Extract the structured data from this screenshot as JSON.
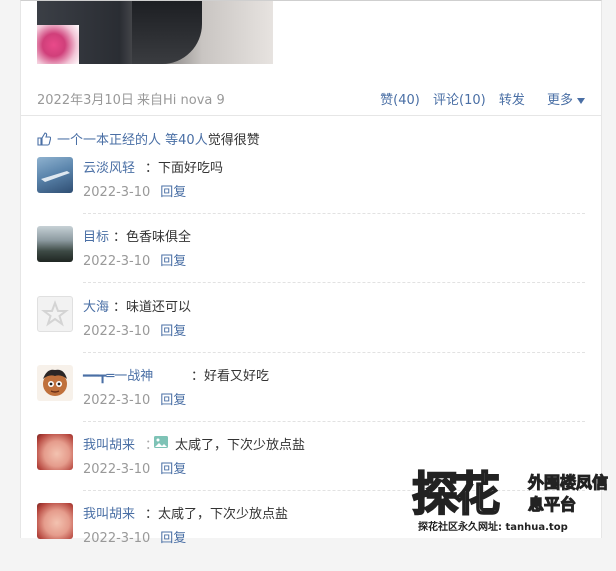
{
  "post": {
    "date": "2022年3月10日",
    "source": "来自Hi nova 9",
    "actions": {
      "like": "赞(40)",
      "comment": "评论(10)",
      "forward": "转发",
      "more": "更多"
    }
  },
  "likes": {
    "user": "一个一本正经的人",
    "count_text": "等40人",
    "suffix": "觉得很赞"
  },
  "comments": [
    {
      "name": "云淡风轻",
      "text": "：下面好吃吗",
      "date": "2022-3-10",
      "reply": "回复"
    },
    {
      "name": "目标",
      "text": "：色香味俱全",
      "date": "2022-3-10",
      "reply": "回复"
    },
    {
      "name": "大海",
      "text": "：味道还可以",
      "date": "2022-3-10",
      "reply": "回复"
    },
    {
      "name": "━━┳═一战神",
      "text": "：好看又好吃",
      "date": "2022-3-10",
      "reply": "回复"
    },
    {
      "name": "我叫胡来",
      "text": "太咸了，下次少放点盐",
      "date": "2022-3-10",
      "reply": "回复"
    },
    {
      "name": "我叫胡来",
      "text": "：太咸了，下次少放点盐",
      "date": "2022-3-10",
      "reply": "回复"
    }
  ],
  "watermark": {
    "big": "探花",
    "side": "外围楼凤信息平台",
    "url": "探花社区永久网址: tanhua.top"
  },
  "colors": {
    "link": "#4a6fa5",
    "muted": "#999999"
  }
}
